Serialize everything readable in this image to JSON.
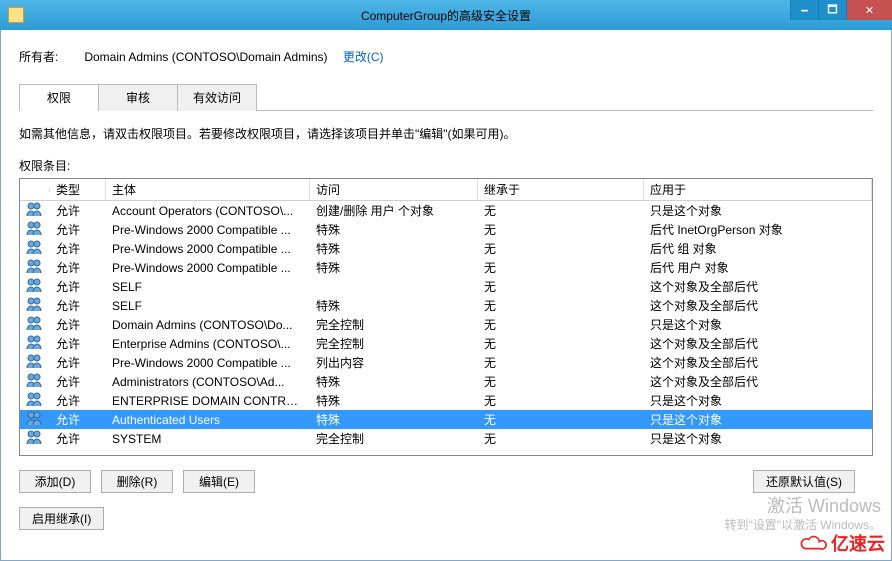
{
  "window": {
    "title": "ComputerGroup的高级安全设置",
    "min_tip": "最小化",
    "max_tip": "最大化",
    "close_tip": "关闭"
  },
  "owner": {
    "label": "所有者:",
    "value": "Domain Admins (CONTOSO\\Domain Admins)",
    "change_link": "更改(C)"
  },
  "tabs": {
    "permissions": "权限",
    "auditing": "审核",
    "effective": "有效访问"
  },
  "instructions": "如需其他信息，请双击权限项目。若要修改权限项目，请选择该项目并单击\"编辑\"(如果可用)。",
  "list_label": "权限条目:",
  "columns": {
    "type": "类型",
    "principal": "主体",
    "access": "访问",
    "inherited": "继承于",
    "applies": "应用于"
  },
  "rows": [
    {
      "type": "允许",
      "principal": "Account Operators (CONTOSO\\...",
      "access": "创建/删除 用户 个对象",
      "inherited": "无",
      "applies": "只是这个对象",
      "selected": false
    },
    {
      "type": "允许",
      "principal": "Pre-Windows 2000 Compatible ...",
      "access": "特殊",
      "inherited": "无",
      "applies": "后代 InetOrgPerson 对象",
      "selected": false
    },
    {
      "type": "允许",
      "principal": "Pre-Windows 2000 Compatible ...",
      "access": "特殊",
      "inherited": "无",
      "applies": "后代 组 对象",
      "selected": false
    },
    {
      "type": "允许",
      "principal": "Pre-Windows 2000 Compatible ...",
      "access": "特殊",
      "inherited": "无",
      "applies": "后代 用户 对象",
      "selected": false
    },
    {
      "type": "允许",
      "principal": "SELF",
      "access": "",
      "inherited": "无",
      "applies": "这个对象及全部后代",
      "selected": false
    },
    {
      "type": "允许",
      "principal": "SELF",
      "access": "特殊",
      "inherited": "无",
      "applies": "这个对象及全部后代",
      "selected": false
    },
    {
      "type": "允许",
      "principal": "Domain Admins (CONTOSO\\Do...",
      "access": "完全控制",
      "inherited": "无",
      "applies": "只是这个对象",
      "selected": false
    },
    {
      "type": "允许",
      "principal": "Enterprise Admins (CONTOSO\\...",
      "access": "完全控制",
      "inherited": "无",
      "applies": "这个对象及全部后代",
      "selected": false
    },
    {
      "type": "允许",
      "principal": "Pre-Windows 2000 Compatible ...",
      "access": "列出内容",
      "inherited": "无",
      "applies": "这个对象及全部后代",
      "selected": false
    },
    {
      "type": "允许",
      "principal": "Administrators (CONTOSO\\Ad...",
      "access": "特殊",
      "inherited": "无",
      "applies": "这个对象及全部后代",
      "selected": false
    },
    {
      "type": "允许",
      "principal": "ENTERPRISE DOMAIN CONTRO...",
      "access": "特殊",
      "inherited": "无",
      "applies": "只是这个对象",
      "selected": false
    },
    {
      "type": "允许",
      "principal": "Authenticated Users",
      "access": "特殊",
      "inherited": "无",
      "applies": "只是这个对象",
      "selected": true
    },
    {
      "type": "允许",
      "principal": "SYSTEM",
      "access": "完全控制",
      "inherited": "无",
      "applies": "只是这个对象",
      "selected": false
    }
  ],
  "buttons": {
    "add": "添加(D)",
    "remove": "删除(R)",
    "edit": "编辑(E)",
    "restore": "还原默认值(S)",
    "enable_inherit": "启用继承(I)"
  },
  "watermark": {
    "l1": "激活 Windows",
    "l2": "转到\"设置\"以激活 Windows。"
  },
  "brand": "亿速云"
}
